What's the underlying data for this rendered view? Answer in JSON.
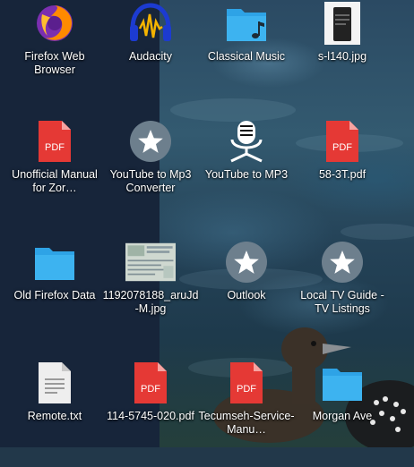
{
  "desktop": {
    "icons": [
      {
        "label": "Firefox Web Browser",
        "icon": "firefox-icon"
      },
      {
        "label": "Audacity",
        "icon": "audacity-icon"
      },
      {
        "label": "Classical Music",
        "icon": "music-folder-icon"
      },
      {
        "label": "s-l140.jpg",
        "icon": "image-file-icon"
      },
      {
        "label": "Unofficial Manual for Zor…",
        "icon": "pdf-file-icon"
      },
      {
        "label": "YouTube to Mp3 Converter",
        "icon": "star-app-icon"
      },
      {
        "label": "YouTube to MP3",
        "icon": "microphone-icon"
      },
      {
        "label": "58-3T.pdf",
        "icon": "pdf-file-icon"
      },
      {
        "label": "Old Firefox Data",
        "icon": "folder-icon"
      },
      {
        "label": "1192078188_aruJd-M.jpg",
        "icon": "image-file-icon"
      },
      {
        "label": "Outlook",
        "icon": "star-app-icon"
      },
      {
        "label": "Local TV Guide - TV Listings",
        "icon": "star-app-icon"
      },
      {
        "label": "Remote.txt",
        "icon": "text-file-icon"
      },
      {
        "label": "114-5745-020.pdf",
        "icon": "pdf-file-icon"
      },
      {
        "label": "Tecumseh-Service-Manu…",
        "icon": "pdf-file-icon"
      },
      {
        "label": "Morgan Ave",
        "icon": "folder-icon"
      }
    ],
    "pdf_badge": "PDF"
  },
  "colors": {
    "folder": "#2ea3e6",
    "pdf": "#e53935",
    "star_app": "#6d7f8d",
    "panel": "#17253a"
  }
}
